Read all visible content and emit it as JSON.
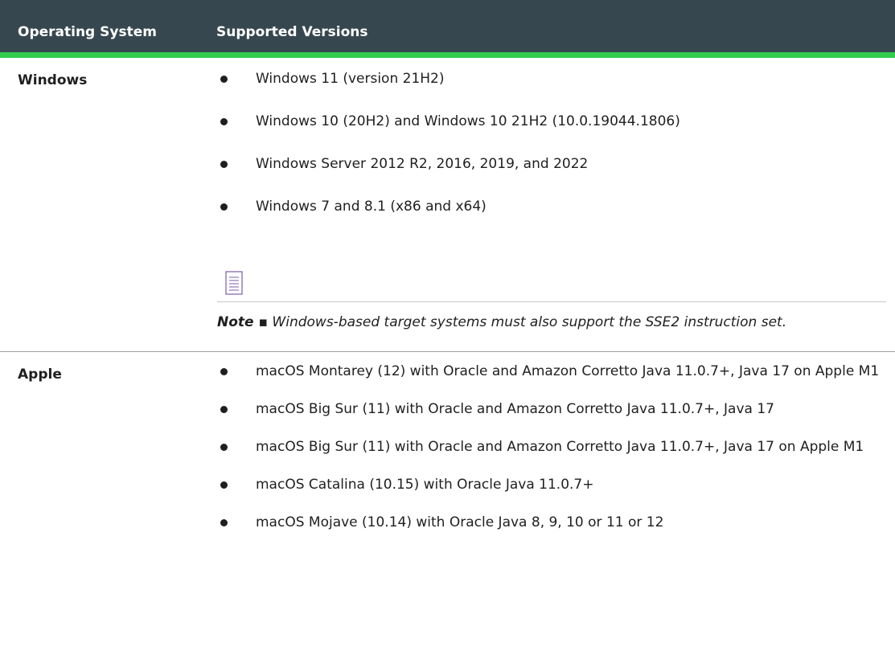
{
  "header": {
    "col_os": "Operating System",
    "col_versions": "Supported Versions"
  },
  "rows": [
    {
      "os": "Windows",
      "versions": [
        "Windows 11 (version 21H2)",
        "Windows 10 (20H2) and Windows 10 21H2 (10.0.19044.1806)",
        "Windows Server 2012 R2, 2016, 2019, and 2022",
        "Windows 7 and 8.1 (x86 and x64)"
      ],
      "note": {
        "icon": "note-icon",
        "label": "Note ▪",
        "text": "Windows-based target systems must also support the SSE2 instruction set."
      }
    },
    {
      "os": "Apple",
      "versions": [
        "macOS Montarey (12) with Oracle and Amazon Corretto Java 11.0.7+, Java 17 on Apple M1",
        "macOS Big Sur (11) with Oracle and Amazon Corretto Java 11.0.7+, Java 17",
        "macOS Big Sur (11) with Oracle and Amazon Corretto Java 11.0.7+, Java 17 on Apple M1",
        "macOS Catalina (10.15) with Oracle Java 11.0.7+",
        "macOS Mojave (10.14) with Oracle Java 8, 9, 10 or 11 or 12"
      ]
    }
  ],
  "colors": {
    "header_bg": "#37474f",
    "header_accent": "#33cc4f",
    "note_icon": "#7a5ea8"
  }
}
